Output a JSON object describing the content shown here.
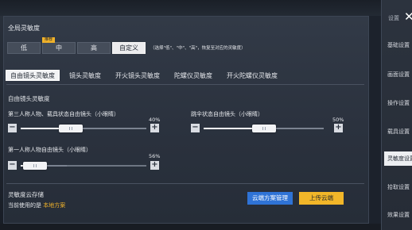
{
  "header": {
    "title": "全局灵敏度",
    "side_tab": "设置"
  },
  "presets": {
    "badge": "推荐",
    "options": [
      "低",
      "中",
      "高",
      "自定义"
    ],
    "selected": "自定义",
    "hint": "（选择\"低\"、\"中\"、\"高\"，恢复至对应的灵敏度）"
  },
  "tabs": [
    "自由镜头灵敏度",
    "镜头灵敏度",
    "开火镜头灵敏度",
    "陀螺仪灵敏度",
    "开火陀螺仪灵敏度"
  ],
  "active_tab": "自由镜头灵敏度",
  "section": {
    "title": "自由镜头灵敏度"
  },
  "sliders": [
    {
      "label": "第三人称人物、载具状态自由镜头（小眼睛）",
      "value": 40,
      "value_text": "40%"
    },
    {
      "label": "跳伞状态自由镜头（小眼睛）",
      "value": 50,
      "value_text": "50%"
    },
    {
      "label": "第一人称人物自由镜头（小眼睛）",
      "value": 56,
      "value_text": "56%"
    }
  ],
  "stepper": {
    "minus": "−",
    "plus": "+"
  },
  "cloud": {
    "title": "灵敏度云存储",
    "current_prefix": "当前使用的是",
    "current_scheme": "本地方案",
    "manage_button": "云端方案管理",
    "upload_button": "上传云端"
  },
  "sidebar": {
    "items": [
      "基础设置",
      "画面设置",
      "操作设置",
      "载具设置",
      "灵敏度设置",
      "拾取设置",
      "效果设置"
    ],
    "active": "灵敏度设置"
  },
  "colors": {
    "accent_blue": "#2f73d6",
    "accent_yellow": "#f2b629",
    "scheme_text": "#f0b22a"
  },
  "icons": {
    "close": "close-icon"
  }
}
